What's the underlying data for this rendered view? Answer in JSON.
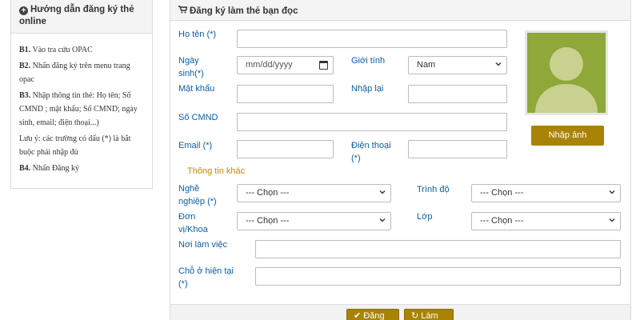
{
  "guide": {
    "title": "Hướng dẫn đăng ký thẻ online",
    "steps": [
      {
        "prefix": "B1.",
        "text": " Vào tra cứu OPAC"
      },
      {
        "prefix": "B2.",
        "text": " Nhấn đăng ký trên menu trang opac"
      },
      {
        "prefix": "B3.",
        "text": " Nhập thông tin thẻ: Họ tên; Số CMND ; mật khẩu; Số CMND; ngày sinh, email; điện thoại...)"
      },
      {
        "prefix": "",
        "text": "Lưu ý: các trường có dấu (*) là bắt buộc phải nhập đủ"
      },
      {
        "prefix": "B4.",
        "text": " Nhấn Đăng ký"
      }
    ]
  },
  "form": {
    "title": "Đăng ký làm thẻ bạn đọc",
    "labels": {
      "fullname": "Họ tên (*)",
      "dob": "Ngày sinh(*)",
      "gender": "Giới tính",
      "password": "Mật khẩu",
      "confirm": "Nhập lại",
      "idcard": "Số CMND",
      "email": "Email (*)",
      "phone": "Điện thoại (*)",
      "other_info": "Thông tin khác",
      "job": "Nghề nghiệp (*)",
      "level": "Trình độ",
      "unit": "Đơn vị/Khoa",
      "class": "Lớp",
      "workplace": "Nơi làm việc",
      "address": "Chỗ ở hiện tại (*)"
    },
    "dob_placeholder": "mm/dd/yyyy",
    "gender_value": "Nam",
    "select_placeholder": "--- Chọn ---",
    "upload_photo": "Nhập ảnh",
    "submit": "Đăng ký",
    "reset": "Làm lại"
  },
  "colors": {
    "label": "#0c5ea8",
    "accent": "#a98306",
    "section": "#c58a00",
    "avatar_bg": "#8ea839"
  }
}
